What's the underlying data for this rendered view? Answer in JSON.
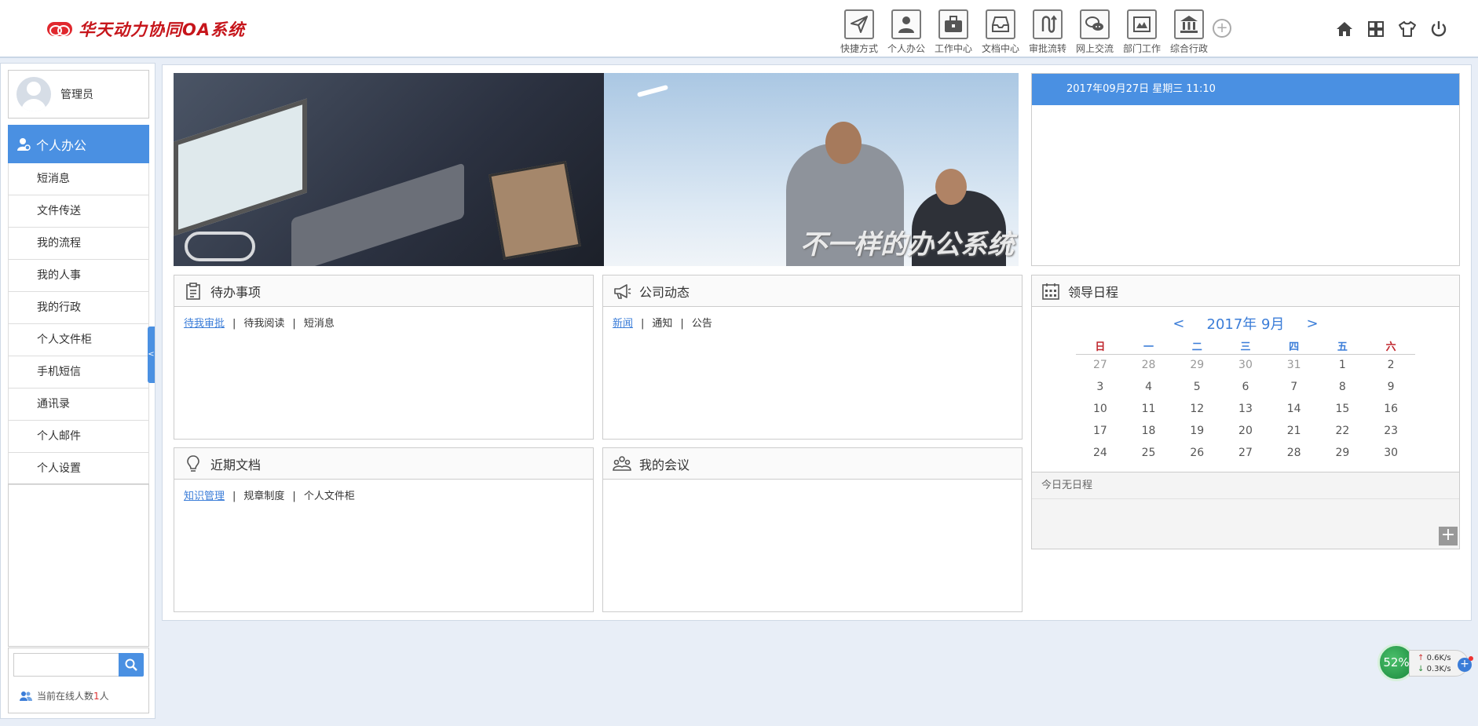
{
  "app": {
    "title": "华天动力协同OA系统"
  },
  "topnav": [
    {
      "label": "快捷方式",
      "icon": "send-icon"
    },
    {
      "label": "个人办公",
      "icon": "person-icon"
    },
    {
      "label": "工作中心",
      "icon": "briefcase-icon"
    },
    {
      "label": "文档中心",
      "icon": "inbox-icon"
    },
    {
      "label": "审批流转",
      "icon": "flow-icon"
    },
    {
      "label": "网上交流",
      "icon": "chat-icon"
    },
    {
      "label": "部门工作",
      "icon": "department-icon"
    },
    {
      "label": "综合行政",
      "icon": "building-icon"
    }
  ],
  "toptools": [
    "home-icon",
    "grid-icon",
    "shirt-icon",
    "power-icon"
  ],
  "user": {
    "name": "管理员"
  },
  "menu": {
    "header": "个人办公",
    "items": [
      "短消息",
      "文件传送",
      "我的流程",
      "我的人事",
      "我的行政",
      "个人文件柜",
      "手机短信",
      "通讯录",
      "个人邮件",
      "个人设置"
    ]
  },
  "search": {
    "placeholder": "",
    "value": ""
  },
  "online": {
    "label": "当前在线人数",
    "count": "1",
    "unit": "人"
  },
  "banner": {
    "slogan": "不一样的办公系统"
  },
  "datebar": {
    "text": "2017年09月27日 星期三 11:10"
  },
  "panels": {
    "todo": {
      "title": "待办事项",
      "tabs": [
        "待我审批",
        "待我阅读",
        "短消息"
      ],
      "active": 0
    },
    "news": {
      "title": "公司动态",
      "tabs": [
        "新闻",
        "通知",
        "公告"
      ],
      "active": 0
    },
    "docs": {
      "title": "近期文档",
      "tabs": [
        "知识管理",
        "规章制度",
        "个人文件柜"
      ],
      "active": 0
    },
    "meet": {
      "title": "我的会议",
      "tabs": []
    },
    "sched": {
      "title": "领导日程",
      "empty": "今日无日程"
    }
  },
  "calendar": {
    "prev": "<",
    "next": ">",
    "title": "2017年 9月",
    "weekdays": [
      "日",
      "一",
      "二",
      "三",
      "四",
      "五",
      "六"
    ],
    "weeks": [
      [
        "27",
        "28",
        "29",
        "30",
        "31",
        "1",
        "2"
      ],
      [
        "3",
        "4",
        "5",
        "6",
        "7",
        "8",
        "9"
      ],
      [
        "10",
        "11",
        "12",
        "13",
        "14",
        "15",
        "16"
      ],
      [
        "17",
        "18",
        "19",
        "20",
        "21",
        "22",
        "23"
      ],
      [
        "24",
        "25",
        "26",
        "27",
        "28",
        "29",
        "30"
      ]
    ],
    "other_month_first_row": 5
  },
  "netwidget": {
    "percent": "52%",
    "up": "0.6K/s",
    "down": "0.3K/s"
  },
  "colors": {
    "accent": "#4a90e2",
    "logo": "#c6151b",
    "weekend": "#c0262d"
  }
}
